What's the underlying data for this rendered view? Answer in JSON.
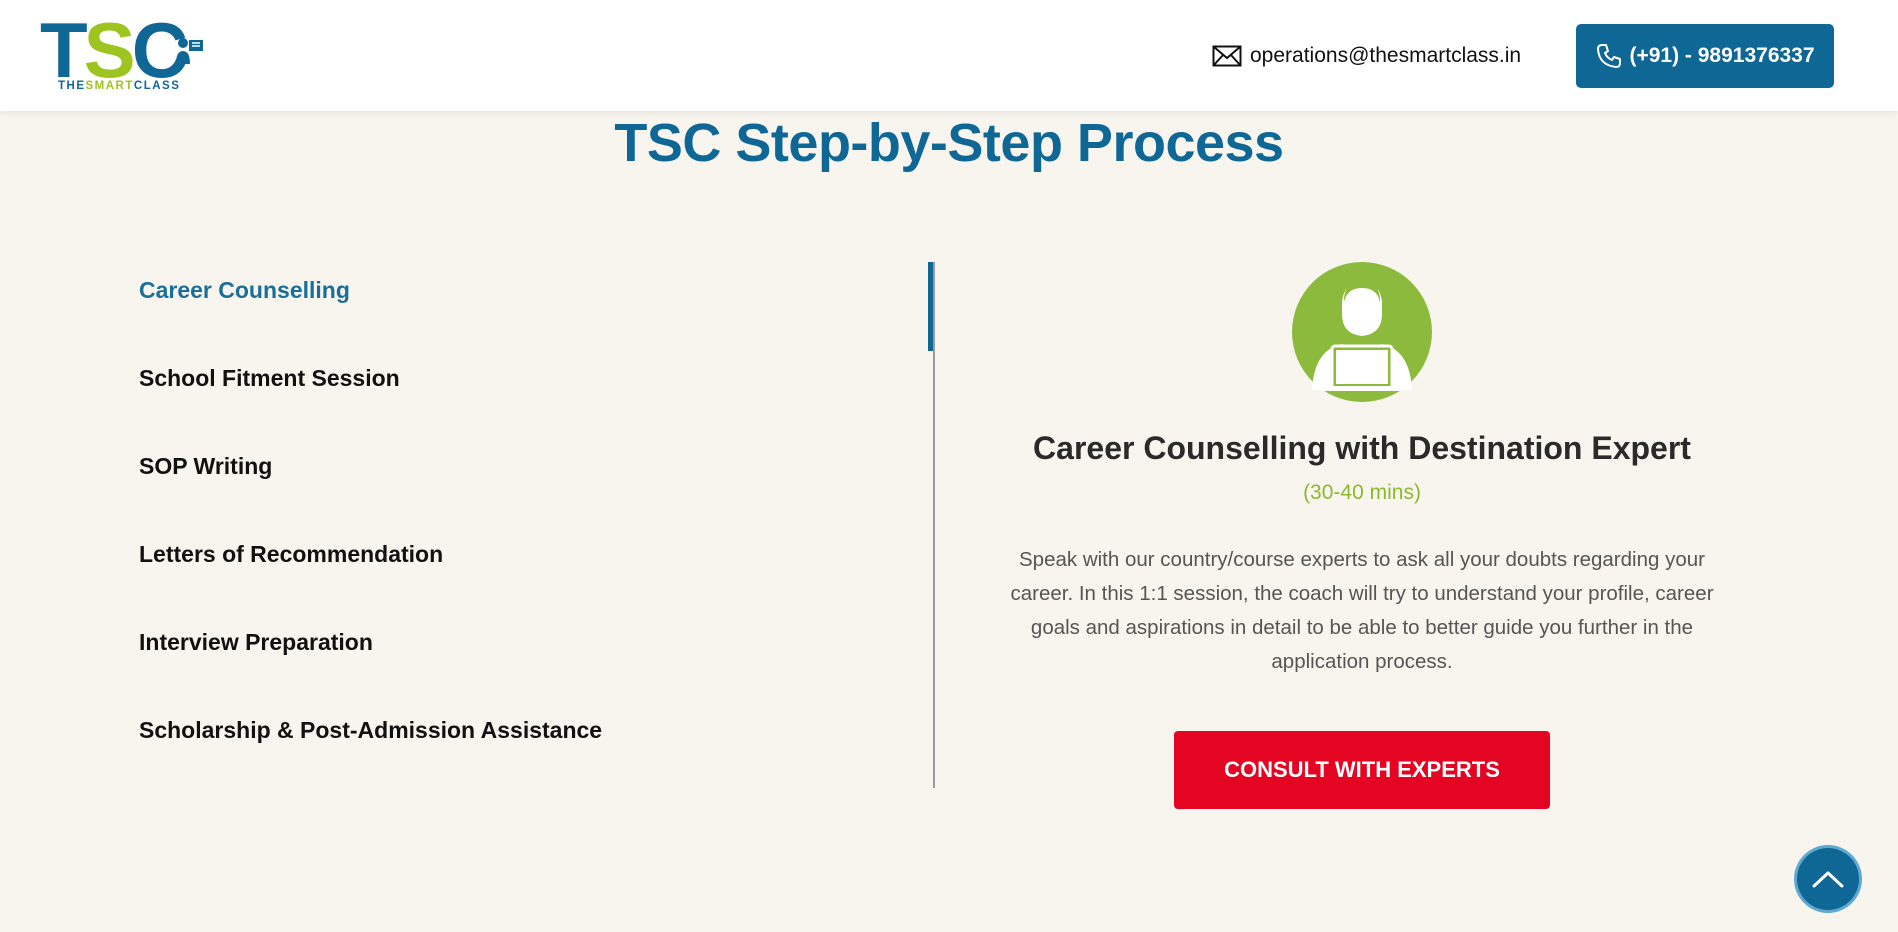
{
  "header": {
    "logo": {
      "letters": [
        "T",
        "S",
        "C"
      ],
      "subtitle_a": "THE",
      "subtitle_b": "SMART",
      "subtitle_c": "CLASS"
    },
    "email": "operations@thesmartclass.in",
    "phone": "(+91) - 9891376337",
    "icons": {
      "email": "envelope-icon",
      "phone": "phone-icon"
    }
  },
  "main": {
    "title": "TSC Step-by-Step Process",
    "steps": [
      {
        "label": "Career Counselling",
        "active": true
      },
      {
        "label": "School Fitment Session",
        "active": false
      },
      {
        "label": "SOP Writing",
        "active": false
      },
      {
        "label": "Letters of Recommendation",
        "active": false
      },
      {
        "label": "Interview Preparation",
        "active": false
      },
      {
        "label": "Scholarship & Post-Admission Assistance",
        "active": false
      }
    ],
    "detail": {
      "title": "Career Counselling with Destination Expert",
      "duration": "(30-40 mins)",
      "description": "Speak with our country/course experts to ask all your doubts regarding your career. In this 1:1 session, the coach will try to understand your profile, career goals and aspirations in detail to be able to better guide you further in the application process.",
      "cta": "CONSULT WITH EXPERTS"
    }
  },
  "colors": {
    "brand_blue": "#0f6796",
    "brand_green": "#9ec41f",
    "cta_red": "#e30521",
    "background": "#f8f5ef"
  }
}
